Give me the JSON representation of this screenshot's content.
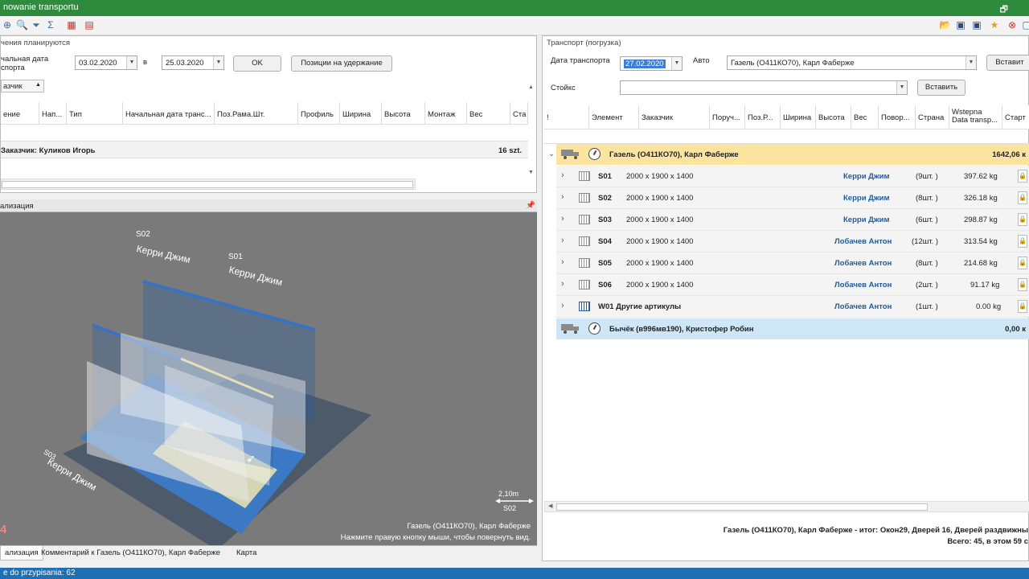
{
  "window": {
    "title": "nowanie transportu"
  },
  "left": {
    "header": "чения планируются",
    "date_label_1": "чальная дата",
    "date_label_2": "спорта",
    "date_from": "03.02.2020",
    "sep": "в",
    "date_to": "25.03.2020",
    "ok": "OK",
    "hold_btn": "Позиции на удержание",
    "filter_chip": "азчик",
    "columns": [
      "ение",
      "Нап...",
      "Тип",
      "Начальная дата транс...",
      "Поз.Рама.Шт.",
      "Профиль",
      "Ширина",
      "Высота",
      "Монтаж",
      "Вес",
      "Ста"
    ],
    "group_row": "Заказчик: Куликов Игорь",
    "group_count": "16 szt."
  },
  "viz": {
    "header": "ализация",
    "label_s02": "S02",
    "label_s02_name": "Керри Джим",
    "label_s01": "S01",
    "label_s01_name": "Керри Джим",
    "label_s03": "S03",
    "label_s03_name": "Керри Джим",
    "scale": "2,10m",
    "scale_label": "S02",
    "vehicle": "Газель (О411КО70), Карл Фаберже",
    "hint": "Нажмите правую кнопку мыши, чтобы повернуть вид.",
    "corner": "4"
  },
  "tabs": [
    "ализация",
    "Комментарий к Газель (О411КО70), Карл Фаберже",
    "Карта"
  ],
  "right": {
    "header": "Транспорт (погрузка)",
    "date_label": "Дата транспорта",
    "date": "27.02.2020",
    "auto_label": "Авто",
    "auto_value": "Газель (О411КО70), Карл Фаберже",
    "insert1": "Вставит",
    "rack_label": "Стойкс",
    "insert2": "Вставить",
    "columns": [
      "!",
      "Элемент",
      "Заказчик",
      "Поруч...",
      "Поз.Р...",
      "Ширина",
      "Высота",
      "Вес",
      "Повор...",
      "Страна",
      "Wstepna Data transp...",
      "Старт"
    ],
    "group1": {
      "name": "Газель (О411КО70), Карл Фаберже",
      "weight": "1642,06 к"
    },
    "rows": [
      {
        "id": "S01",
        "dims": "2000 x 1900 x 1400",
        "customer": "Керри Джим",
        "qty": "(9шт. )",
        "weight": "397.62 kg"
      },
      {
        "id": "S02",
        "dims": "2000 x 1900 x 1400",
        "customer": "Керри Джим",
        "qty": "(8шт. )",
        "weight": "326.18 kg"
      },
      {
        "id": "S03",
        "dims": "2000 x 1900 x 1400",
        "customer": "Керри Джим",
        "qty": "(6шт. )",
        "weight": "298.87 kg"
      },
      {
        "id": "S04",
        "dims": "2000 x 1900 x 1400",
        "customer": "Лобачев Антон",
        "qty": "(12шт. )",
        "weight": "313.54 kg"
      },
      {
        "id": "S05",
        "dims": "2000 x 1900 x 1400",
        "customer": "Лобачев Антон",
        "qty": "(8шт. )",
        "weight": "214.68 kg"
      },
      {
        "id": "S06",
        "dims": "2000 x 1900 x 1400",
        "customer": "Лобачев Антон",
        "qty": "(2шт. )",
        "weight": "91.17 kg"
      },
      {
        "id": "W01 Другие артикулы",
        "dims": "",
        "customer": "Лобачев Антон",
        "qty": "(1шт. )",
        "weight": "0.00 kg"
      }
    ],
    "group2": {
      "name": "Бычёк (в996мв190), Кристофер Робин",
      "weight": "0,00 к"
    },
    "summary1": "Газель (О411КО70), Карл Фаберже - итог: Окон29, Дверей 16, Дверей раздвижны",
    "summary2": "Всего: 45, в этом 59 с"
  },
  "status": {
    "text": "e do przypisania: 62"
  },
  "colors": {
    "titlebar": "#2e8b3e",
    "statusbar": "#1f6fb5",
    "group_yellow": "#fbe3a0",
    "group_blue": "#cfe6f6",
    "customer_blue": "#1f5b99"
  }
}
